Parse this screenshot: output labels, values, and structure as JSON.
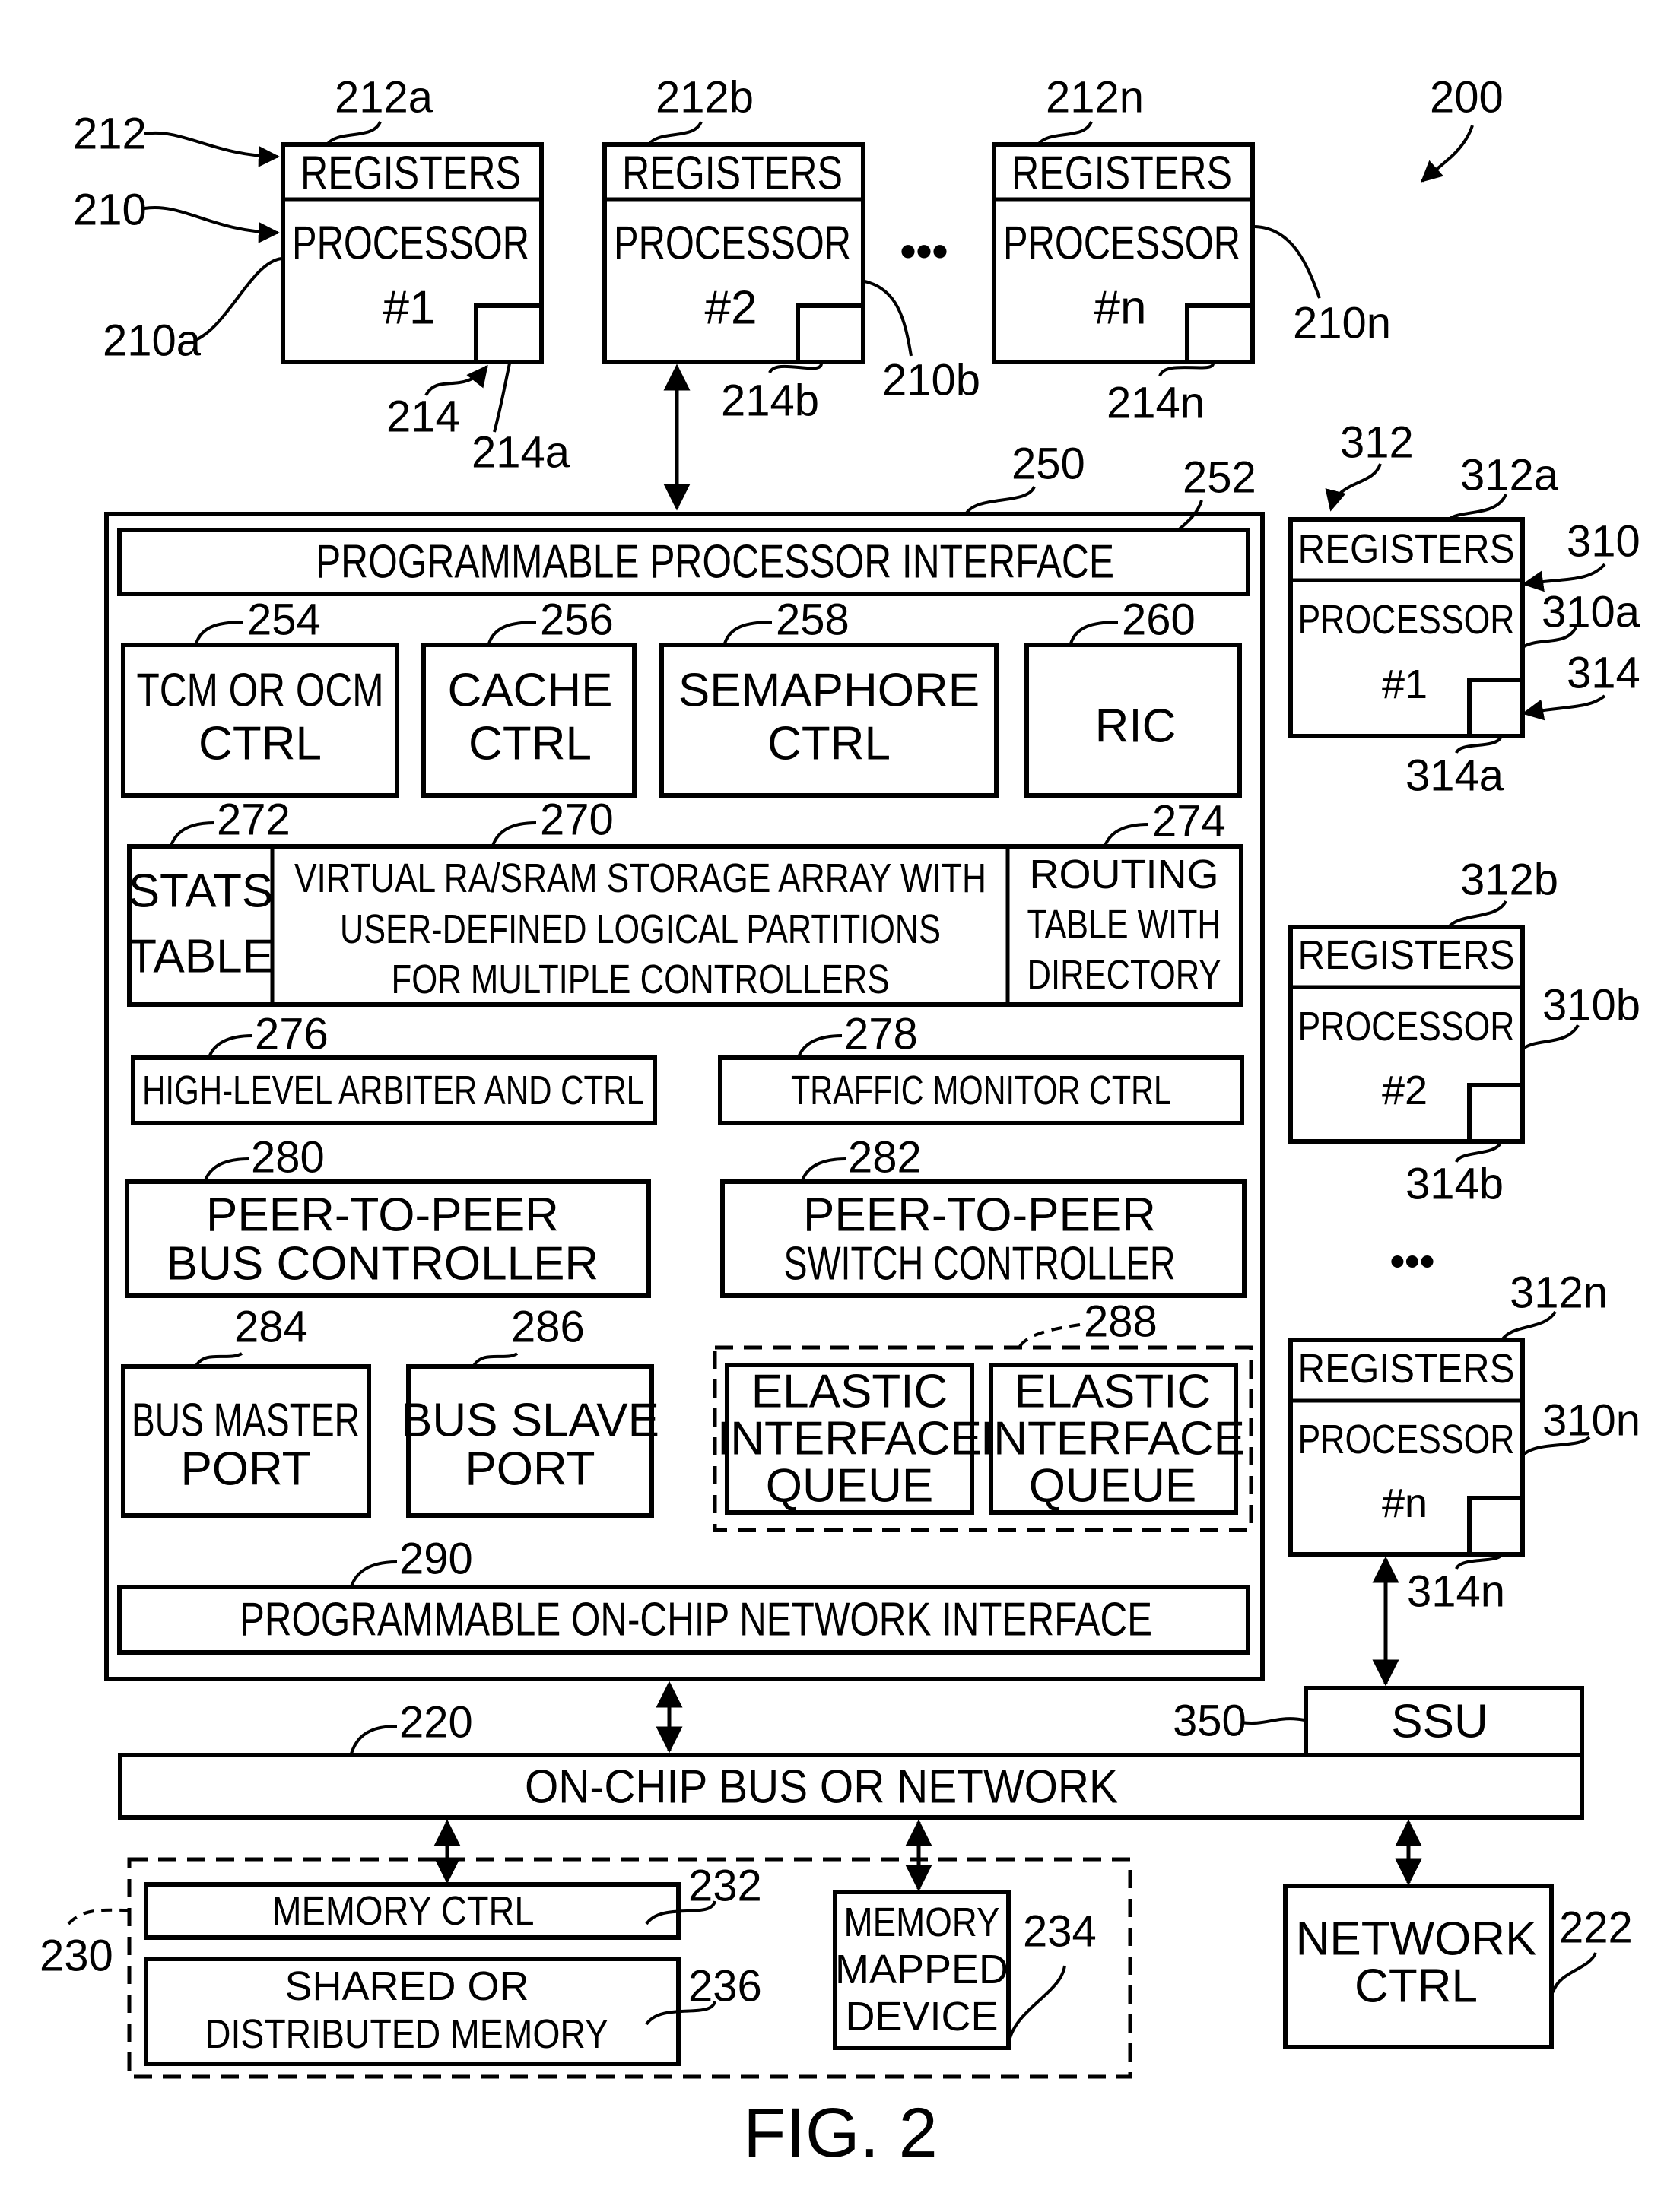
{
  "figure": {
    "caption": "FIG. 2",
    "system_ref": "200"
  },
  "top_processors": [
    {
      "registers_label": "REGISTERS",
      "processor_label": "PROCESSOR",
      "number_label": "#1",
      "registers_ref": "212a",
      "processor_ref": "210a",
      "cache_ref": "214a"
    },
    {
      "registers_label": "REGISTERS",
      "processor_label": "PROCESSOR",
      "number_label": "#2",
      "registers_ref": "212b",
      "processor_ref": "210b",
      "cache_ref": "214b"
    },
    {
      "registers_label": "REGISTERS",
      "processor_label": "PROCESSOR",
      "number_label": "#n",
      "registers_ref": "212n",
      "processor_ref": "210n",
      "cache_ref": "214n"
    }
  ],
  "top_group_refs": {
    "registers": "212",
    "processor": "210",
    "cache": "214"
  },
  "ellipsis": "•••",
  "interface_block": {
    "ref": "250",
    "processor_interface": {
      "label": "PROGRAMMABLE PROCESSOR INTERFACE",
      "ref": "252"
    },
    "controllers": [
      {
        "lines": [
          "TCM OR OCM",
          "CTRL"
        ],
        "ref": "254"
      },
      {
        "lines": [
          "CACHE",
          "CTRL"
        ],
        "ref": "256"
      },
      {
        "lines": [
          "SEMAPHORE",
          "CTRL"
        ],
        "ref": "258"
      },
      {
        "lines": [
          "RIC"
        ],
        "ref": "260"
      }
    ],
    "stats_table": {
      "lines": [
        "STATS",
        "TABLE"
      ],
      "ref": "272"
    },
    "storage_array": {
      "lines": [
        "VIRTUAL RA/SRAM STORAGE ARRAY WITH",
        "USER-DEFINED LOGICAL PARTITIONS",
        "FOR MULTIPLE CONTROLLERS"
      ],
      "ref": "270"
    },
    "routing_table": {
      "lines": [
        "ROUTING",
        "TABLE WITH",
        "DIRECTORY"
      ],
      "ref": "274"
    },
    "arbiter": {
      "label": "HIGH-LEVEL  ARBITER AND CTRL",
      "ref": "276"
    },
    "traffic_monitor": {
      "label": "TRAFFIC MONITOR CTRL",
      "ref": "278"
    },
    "p2p_bus": {
      "lines": [
        "PEER-TO-PEER",
        "BUS CONTROLLER"
      ],
      "ref": "280"
    },
    "p2p_switch": {
      "lines": [
        "PEER-TO-PEER",
        "SWITCH CONTROLLER"
      ],
      "ref": "282"
    },
    "bus_master": {
      "lines": [
        "BUS MASTER",
        "PORT"
      ],
      "ref": "284"
    },
    "bus_slave": {
      "lines": [
        "BUS SLAVE",
        "PORT"
      ],
      "ref": "286"
    },
    "elastic_queues": {
      "ref": "288",
      "queues": [
        {
          "lines": [
            "ELASTIC",
            "INTERFACE",
            "QUEUE"
          ]
        },
        {
          "lines": [
            "ELASTIC",
            "INTERFACE",
            "QUEUE"
          ]
        }
      ]
    },
    "network_interface": {
      "label": "PROGRAMMABLE ON-CHIP NETWORK INTERFACE",
      "ref": "290"
    }
  },
  "bus": {
    "label": "ON-CHIP BUS OR NETWORK",
    "ref": "220"
  },
  "ssu": {
    "label": "SSU",
    "ref": "350"
  },
  "memory_subsystem": {
    "ref": "230",
    "memory_ctrl": {
      "label": "MEMORY CTRL",
      "ref": "232"
    },
    "shared_memory": {
      "lines": [
        "SHARED OR",
        "DISTRIBUTED MEMORY"
      ],
      "ref": "236"
    },
    "mapped_device": {
      "lines": [
        "MEMORY",
        "MAPPED",
        "DEVICE"
      ],
      "ref": "234"
    }
  },
  "network_ctrl": {
    "lines": [
      "NETWORK",
      "CTRL"
    ],
    "ref": "222"
  },
  "right_processors": [
    {
      "registers_label": "REGISTERS",
      "processor_label": "PROCESSOR",
      "number_label": "#1",
      "registers_ref": "312a",
      "processor_ref": "310a",
      "cache_ref": "314a"
    },
    {
      "registers_label": "REGISTERS",
      "processor_label": "PROCESSOR",
      "number_label": "#2",
      "registers_ref": "312b",
      "processor_ref": "310b",
      "cache_ref": "314b"
    },
    {
      "registers_label": "REGISTERS",
      "processor_label": "PROCESSOR",
      "number_label": "#n",
      "registers_ref": "312n",
      "processor_ref": "310n",
      "cache_ref": "314n"
    }
  ],
  "right_group_refs": {
    "registers": "312",
    "processor": "310",
    "cache": "314"
  }
}
